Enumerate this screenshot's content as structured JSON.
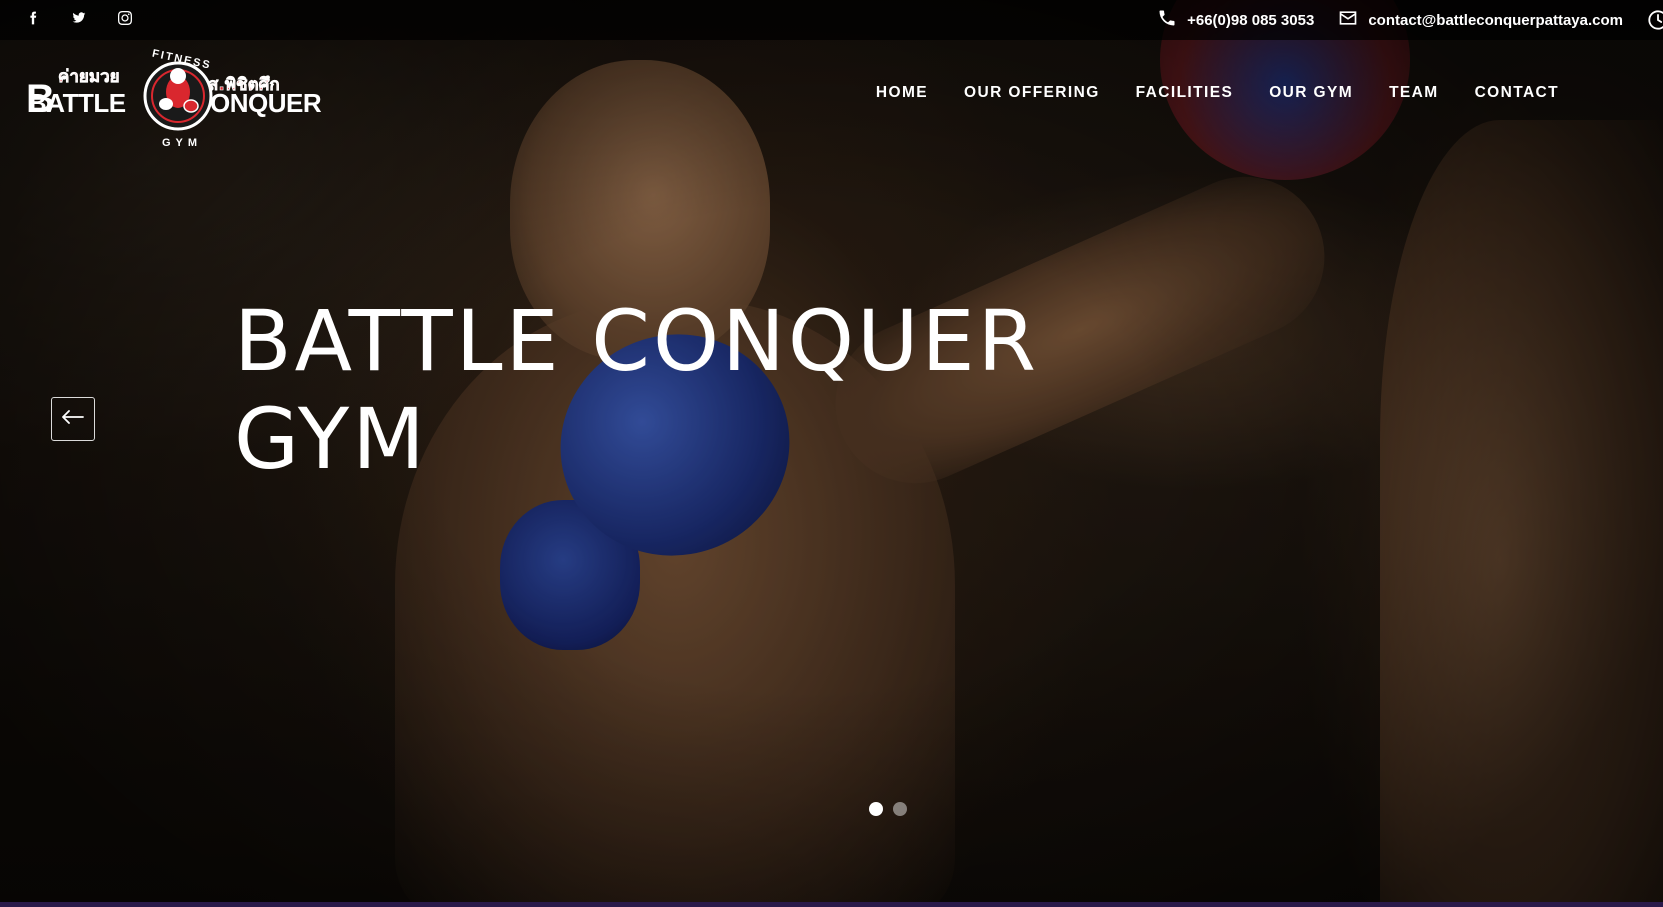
{
  "topbar": {
    "social": [
      {
        "icon": "facebook-icon"
      },
      {
        "icon": "twitter-icon"
      },
      {
        "icon": "instagram-icon"
      }
    ],
    "phone": "+66(0)98 085 3053",
    "email": "contact@battleconquerpattaya.com"
  },
  "logo": {
    "top_arc": "FITNESS",
    "thai_left": "ค่ายมวย",
    "thai_right": "ส.พิชิตศึก",
    "left_word": "BATTLE",
    "right_word": "ONQUER",
    "bottom_arc": "GYM"
  },
  "nav": {
    "items": [
      {
        "label": "HOME"
      },
      {
        "label": "OUR OFFERING"
      },
      {
        "label": "FACILITIES"
      },
      {
        "label": "OUR GYM"
      },
      {
        "label": "TEAM"
      },
      {
        "label": "CONTACT"
      }
    ]
  },
  "hero": {
    "title_line1": "BATTLE CONQUER",
    "title_line2": "GYM",
    "active_slide": 1,
    "slide_count": 2
  },
  "colors": {
    "logo_red": "#d9272e",
    "bottom_strip": "#2a1a4a"
  }
}
